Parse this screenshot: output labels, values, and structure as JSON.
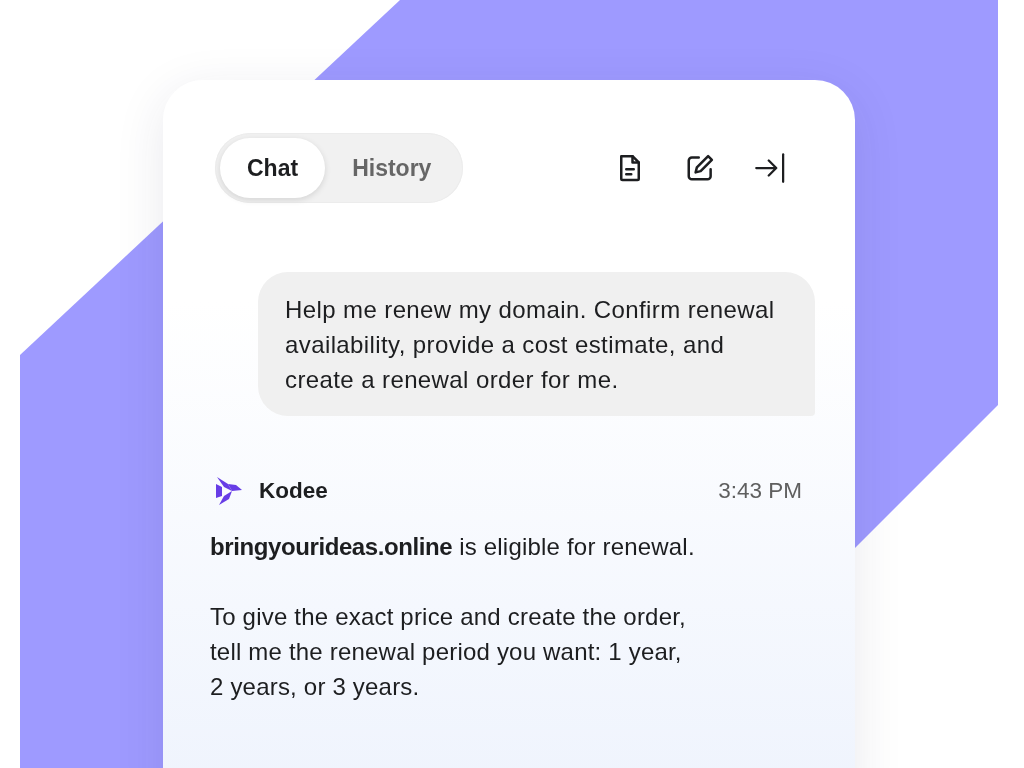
{
  "tabs": [
    {
      "label": "Chat",
      "selected": true
    },
    {
      "label": "History",
      "selected": false
    }
  ],
  "messages": [
    {
      "kind": "user",
      "text": "Help me renew my domain. Confirm renewal availability, provide a cost estimate, and create a renewal order for me."
    },
    {
      "kind": "assistant",
      "sender": "Kodee",
      "time": "3:43 PM",
      "paragraphs": [
        "**bringyourideas.online** is eligible for renewal.",
        "To give the exact price and create the order, tell me the renewal period you want: 1 year, 2 years, or 3 years."
      ]
    }
  ]
}
